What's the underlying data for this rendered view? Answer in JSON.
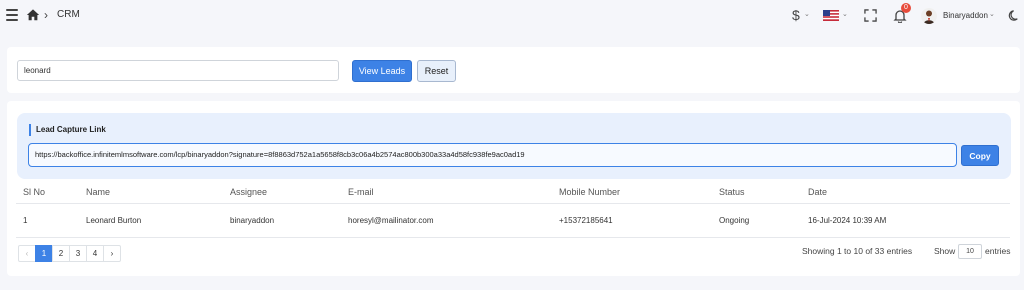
{
  "topbar": {
    "breadcrumb_sep": "›",
    "breadcrumb": "CRM",
    "currency_symbol": "$",
    "notifications": "0",
    "username": "Binaryaddon"
  },
  "search": {
    "value": "leonard",
    "view_label": "View Leads",
    "reset_label": "Reset"
  },
  "lead_capture": {
    "title": "Lead Capture Link",
    "link": "https://backoffice.infinitemlmsoftware.com/lcp/binaryaddon?signature=8f8863d752a1a5658f8cb3c06a4b2574ac800b300a33a4d58fc938fe9ac0ad19",
    "copy_label": "Copy"
  },
  "table": {
    "headers": [
      "Sl No",
      "Name",
      "Assignee",
      "E-mail",
      "Mobile Number",
      "Status",
      "Date"
    ],
    "rows": [
      [
        "1",
        "Leonard Burton",
        "binaryaddon",
        "horesyl@mailinator.com",
        "+15372185641",
        "Ongoing",
        "16-Jul-2024 10:39 AM"
      ]
    ]
  },
  "pagination": {
    "prev": "‹",
    "pages": [
      "1",
      "2",
      "3",
      "4"
    ],
    "next": "›",
    "showing": "Showing 1 to 10 of 33 entries",
    "show_label": "Show",
    "per_page": "10",
    "entries_label": "entries"
  },
  "colors": {
    "accent": "#3d82e6",
    "badge": "#e74c3c",
    "panel": "#e8f0fd"
  },
  "icons": [
    "hamburger-menu-icon",
    "home-icon",
    "dollar-icon",
    "us-flag-icon",
    "fullscreen-icon",
    "bell-icon",
    "avatar",
    "moon-icon"
  ]
}
